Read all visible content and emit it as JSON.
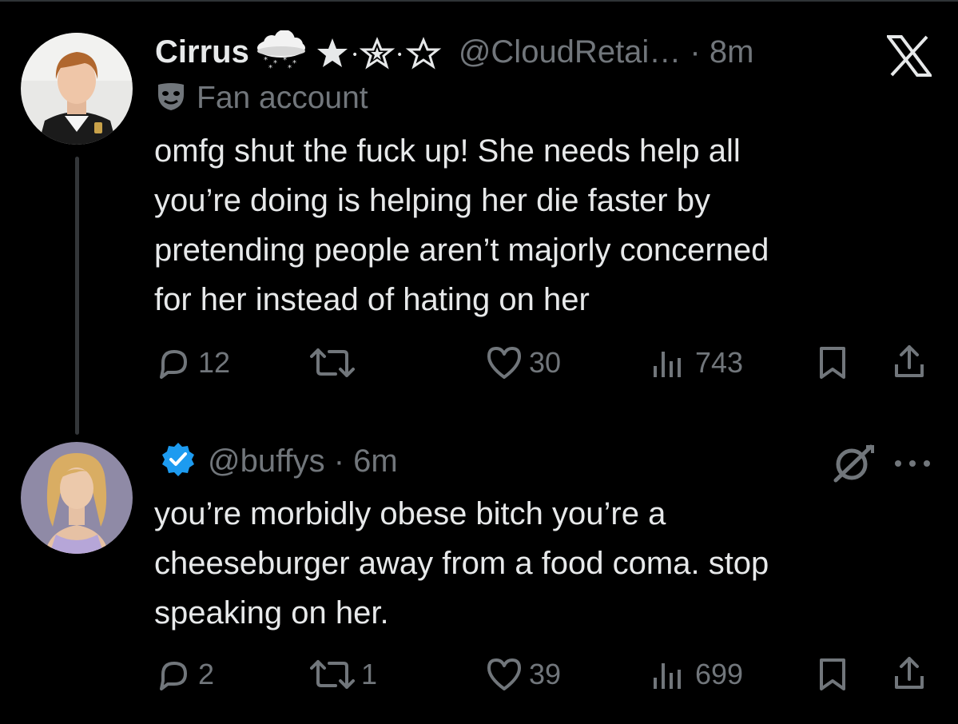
{
  "tweet1": {
    "name": "Cirrus",
    "handle": "@CloudRetai… · 8m",
    "badge_label": "Fan account",
    "text_lines": [
      "omfg shut the fuck up! She needs help all",
      "you’re doing is helping her die faster by",
      "pretending people aren’t majorly concerned",
      "for her instead of hating on her"
    ],
    "replies": "12",
    "reposts": "",
    "likes": "30",
    "views": "743"
  },
  "tweet2": {
    "handle": "@buffys · 6m",
    "text_lines": [
      "you’re morbidly obese bitch you’re a",
      "cheeseburger away from a food coma. stop",
      "speaking on her."
    ],
    "replies": "2",
    "reposts": "1",
    "likes": "39",
    "views": "699"
  },
  "icons": {
    "app_logo": "x-logo-icon",
    "verified": "verified-badge-icon",
    "fan_badge": "mask-icon",
    "cloud": "snow-cloud-icon",
    "grok": "grok-icon",
    "more": "more-icon"
  },
  "colors": {
    "background": "#000000",
    "text": "#e7e9ea",
    "secondary": "#71767b",
    "verified": "#1d9bf0",
    "thread_line": "#333639"
  }
}
